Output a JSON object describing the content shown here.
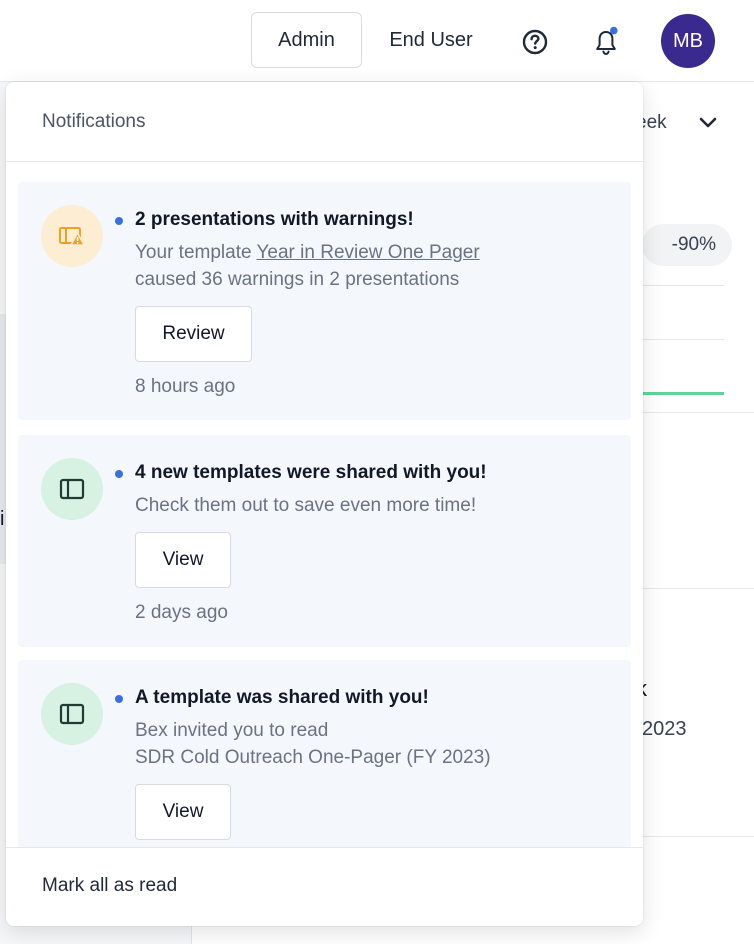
{
  "topbar": {
    "admin_label": "Admin",
    "end_user_label": "End User",
    "avatar_initials": "MB",
    "avatar_color": "#3a2a8f",
    "bell_unread_dot_color": "#3b6fe0"
  },
  "background": {
    "week_label": "eek",
    "change_pill": "-90%",
    "partial_k": "k",
    "partial_year": "2023",
    "partial_left_char": "i"
  },
  "notifications": {
    "title": "Notifications",
    "mark_all_label": "Mark all as read",
    "items": [
      {
        "icon": "template-warning-icon",
        "title": "2 presentations with warnings!",
        "body_prefix": "Your template ",
        "body_link": "Year in Review One Pager",
        "body_line2": "caused 36 warnings in 2 presentations",
        "button_label": "Review",
        "time": "8 hours ago"
      },
      {
        "icon": "template-icon",
        "title": "4 new templates were shared with you!",
        "body_line1": "Check them out to save even more time!",
        "button_label": "View",
        "time": "2 days ago"
      },
      {
        "icon": "template-icon",
        "title": "A template was shared with you!",
        "body_line1": "Bex invited you to read",
        "body_line2": "SDR Cold Outreach One-Pager (FY 2023)",
        "button_label": "View"
      }
    ]
  },
  "colors": {
    "warn_icon_bg": "#fdeed3",
    "share_icon_bg": "#d7f1e3",
    "unread_dot": "#3b6fe0",
    "card_bg": "#f4f7fc"
  }
}
